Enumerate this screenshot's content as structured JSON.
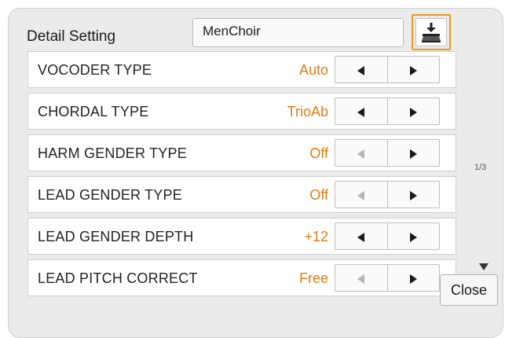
{
  "header": {
    "title": "Detail Setting",
    "preset_name": "MenChoir",
    "save_icon": "save-icon"
  },
  "rows": [
    {
      "label": "VOCODER TYPE",
      "value": "Auto",
      "left_enabled": true,
      "right_enabled": true
    },
    {
      "label": "CHORDAL TYPE",
      "value": "TrioAb",
      "left_enabled": true,
      "right_enabled": true
    },
    {
      "label": "HARM GENDER TYPE",
      "value": "Off",
      "left_enabled": false,
      "right_enabled": true
    },
    {
      "label": "LEAD GENDER TYPE",
      "value": "Off",
      "left_enabled": false,
      "right_enabled": true
    },
    {
      "label": "LEAD GENDER DEPTH",
      "value": "+12",
      "left_enabled": true,
      "right_enabled": true
    },
    {
      "label": "LEAD PITCH CORRECT",
      "value": "Free",
      "left_enabled": false,
      "right_enabled": true
    }
  ],
  "pager": {
    "indicator": "1/3"
  },
  "footer": {
    "close_label": "Close"
  },
  "colors": {
    "accent": "#ef9a1e",
    "value_text": "#e07c15",
    "panel_bg": "#ebebeb"
  }
}
